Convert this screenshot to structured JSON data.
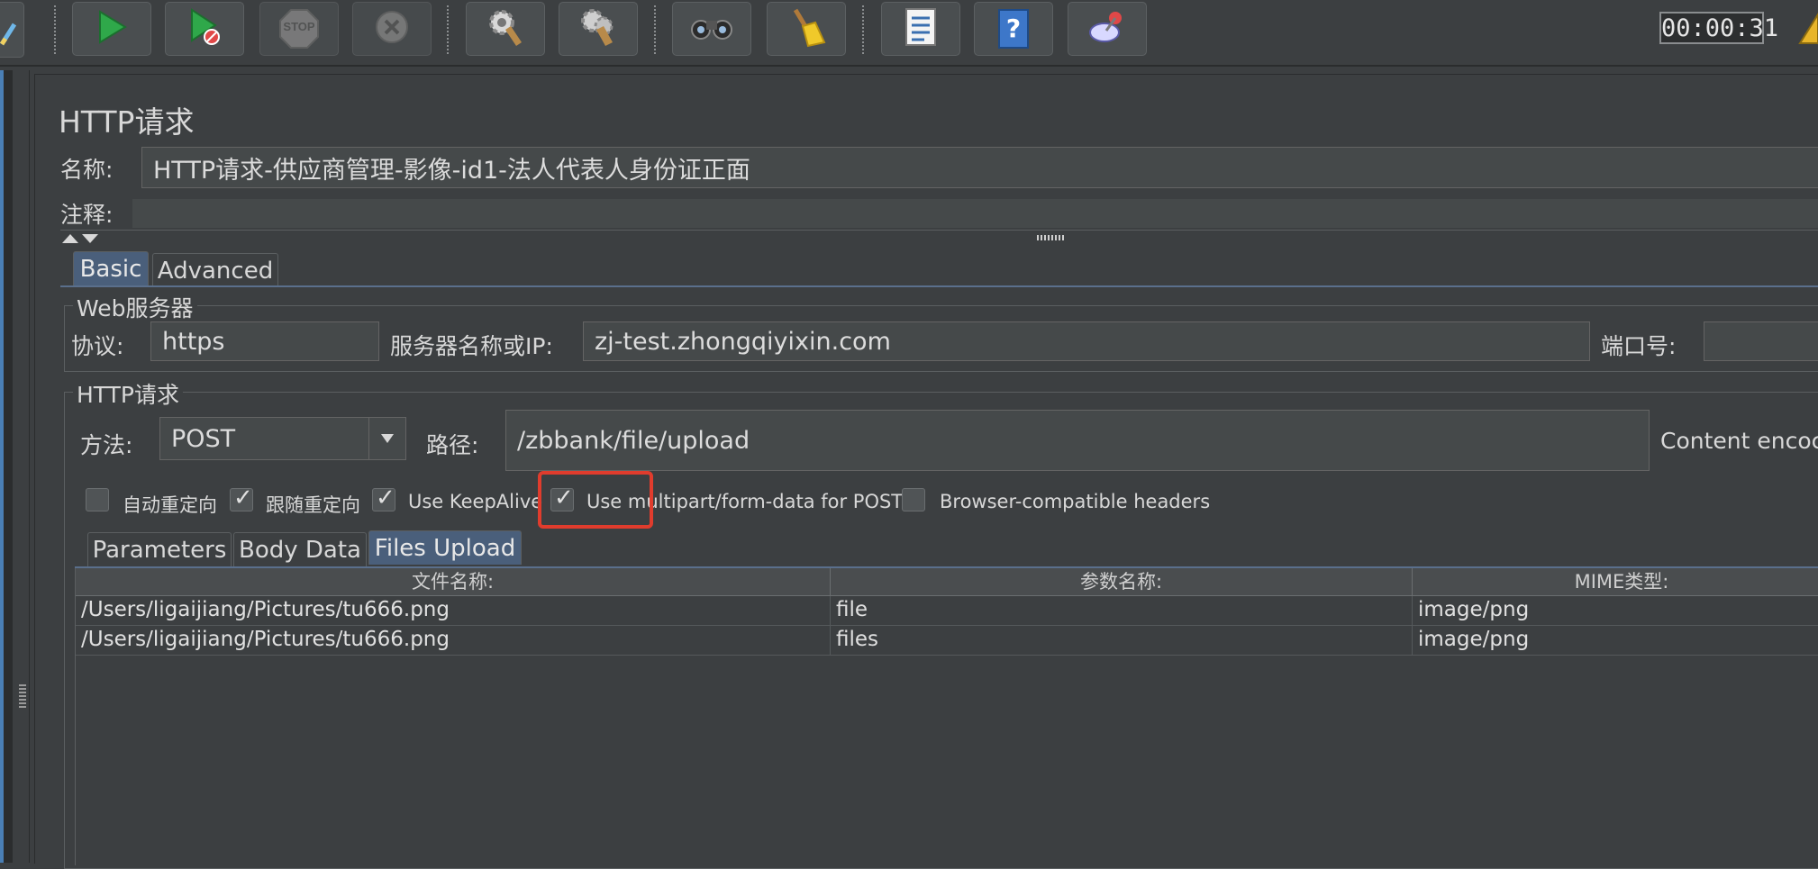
{
  "toolbar": {
    "buttons": [
      {
        "name": "edit",
        "icon": "pencil-icon"
      },
      {
        "name": "start",
        "icon": "play-icon"
      },
      {
        "name": "start-no-pauses",
        "icon": "play-no-timer-icon"
      },
      {
        "name": "stop",
        "icon": "stop-icon",
        "label": "STOP"
      },
      {
        "name": "shutdown",
        "icon": "shutdown-icon"
      },
      {
        "name": "clear",
        "icon": "clear-gear-icon"
      },
      {
        "name": "clear-all",
        "icon": "clear-all-icon"
      },
      {
        "name": "search",
        "icon": "binoculars-icon"
      },
      {
        "name": "reset-search",
        "icon": "broom-icon"
      },
      {
        "name": "function-helper",
        "icon": "list-icon"
      },
      {
        "name": "help",
        "icon": "help-book-icon",
        "label": "?"
      },
      {
        "name": "remote",
        "icon": "remote-icon"
      }
    ],
    "timer": "00:00:31",
    "warning_icon": "warning-icon"
  },
  "panel": {
    "title": "HTTP请求",
    "name_label": "名称:",
    "name_value": "HTTP请求-供应商管理-影像-id1-法人代表人身份证正面",
    "comment_label": "注释:",
    "comment_value": ""
  },
  "tabs": {
    "basic": "Basic",
    "advanced": "Advanced"
  },
  "web_server": {
    "title": "Web服务器",
    "protocol_label": "协议:",
    "protocol_value": "https",
    "server_label": "服务器名称或IP:",
    "server_value": "zj-test.zhongqiyixin.com",
    "port_label": "端口号:",
    "port_value": ""
  },
  "http_request": {
    "title": "HTTP请求",
    "method_label": "方法:",
    "method_value": "POST",
    "path_label": "路径:",
    "path_value": "/zbbank/file/upload",
    "content_encoding_label": "Content encoc"
  },
  "options": [
    {
      "label": "自动重定向",
      "checked": false
    },
    {
      "label": "跟随重定向",
      "checked": true
    },
    {
      "label": "Use KeepAlive",
      "checked": true
    },
    {
      "label": "Use multipart/form-data for POST",
      "checked": true
    },
    {
      "label": "Browser-compatible headers",
      "checked": false
    }
  ],
  "sub_tabs": {
    "parameters": "Parameters",
    "body_data": "Body Data",
    "files_upload": "Files Upload"
  },
  "files_table": {
    "columns": [
      "文件名称:",
      "参数名称:",
      "MIME类型:"
    ],
    "rows": [
      [
        "/Users/ligaijiang/Pictures/tu666.png",
        "file",
        "image/png"
      ],
      [
        "/Users/ligaijiang/Pictures/tu666.png",
        "files",
        "image/png"
      ]
    ]
  },
  "colors": {
    "background": "#3c3f41",
    "active_tab": "#4a5f7b",
    "highlight": "#e03c2d"
  }
}
